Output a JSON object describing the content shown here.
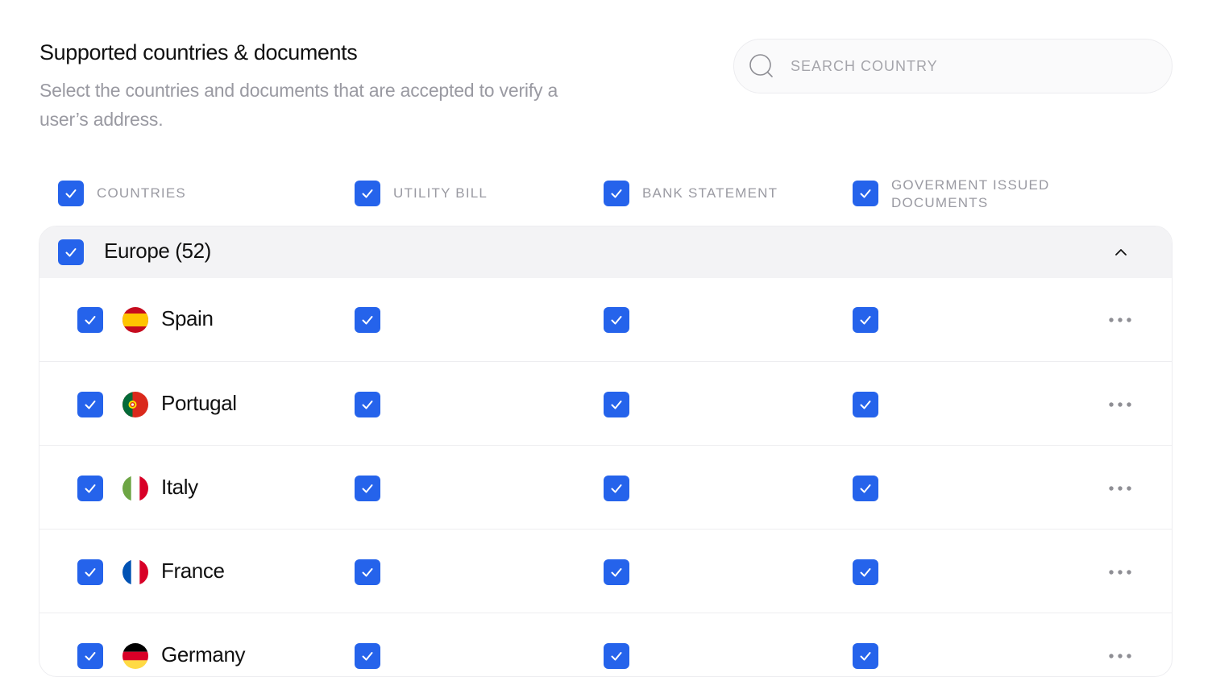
{
  "header": {
    "title": "Supported countries & documents",
    "subtitle": "Select the countries and documents that are accepted to verify a user’s address."
  },
  "search": {
    "placeholder": "SEARCH COUNTRY",
    "value": "",
    "icon": "search-icon"
  },
  "columns": [
    {
      "label": "COUNTRIES",
      "checked": true
    },
    {
      "label": "UTILITY BILL",
      "checked": true
    },
    {
      "label": "BANK STATEMENT",
      "checked": true
    },
    {
      "label": "GOVERMENT ISSUED DOCUMENTS",
      "checked": true
    }
  ],
  "group": {
    "label": "Europe (52)",
    "checked": true,
    "expanded": true,
    "icon": "chevron-up-icon"
  },
  "rows": [
    {
      "country": "Spain",
      "flag": "spain-flag-icon",
      "selected": true,
      "utility_bill": true,
      "bank_statement": true,
      "government_documents": true
    },
    {
      "country": "Portugal",
      "flag": "portugal-flag-icon",
      "selected": true,
      "utility_bill": true,
      "bank_statement": true,
      "government_documents": true
    },
    {
      "country": "Italy",
      "flag": "italy-flag-icon",
      "selected": true,
      "utility_bill": true,
      "bank_statement": true,
      "government_documents": true
    },
    {
      "country": "France",
      "flag": "france-flag-icon",
      "selected": true,
      "utility_bill": true,
      "bank_statement": true,
      "government_documents": true
    },
    {
      "country": "Germany",
      "flag": "germany-flag-icon",
      "selected": true,
      "utility_bill": true,
      "bank_statement": true,
      "government_documents": true
    }
  ],
  "row_actions_icon": "more-horizontal-icon",
  "colors": {
    "accent": "#2563eb",
    "muted_text": "#9a9aa2",
    "group_background": "#f3f3f5"
  }
}
